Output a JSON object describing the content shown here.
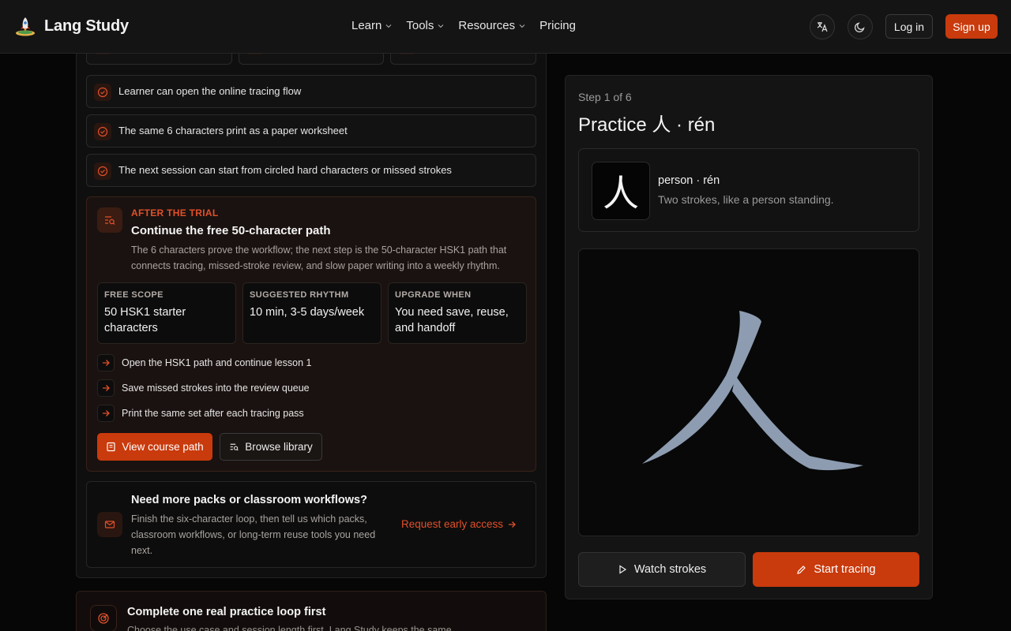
{
  "header": {
    "brand": "Lang Study",
    "nav": [
      {
        "label": "Learn",
        "has_menu": true
      },
      {
        "label": "Tools",
        "has_menu": true
      },
      {
        "label": "Resources",
        "has_menu": true
      },
      {
        "label": "Pricing",
        "has_menu": false
      }
    ],
    "login_label": "Log in",
    "signup_label": "Sign up",
    "icons": [
      "translate-icon",
      "moon-icon"
    ]
  },
  "checklist": [
    "Learner can open the online tracing flow",
    "The same 6 characters print as a paper worksheet",
    "The next session can start from circled hard characters or missed strokes"
  ],
  "trial": {
    "eyebrow": "AFTER THE TRIAL",
    "title": "Continue the free 50-character path",
    "description": "The 6 characters prove the workflow; the next step is the 50-character HSK1 path that connects tracing, missed-stroke review, and slow paper writing into a weekly rhythm.",
    "stats": [
      {
        "label": "FREE SCOPE",
        "value": "50 HSK1 starter characters"
      },
      {
        "label": "SUGGESTED RHYTHM",
        "value": "10 min, 3-5 days/week"
      },
      {
        "label": "UPGRADE WHEN",
        "value": "You need save, reuse, and handoff"
      }
    ],
    "steps": [
      "Open the HSK1 path and continue lesson 1",
      "Save missed strokes into the review queue",
      "Print the same set after each tracing pass"
    ],
    "primary_label": "View course path",
    "secondary_label": "Browse library"
  },
  "more": {
    "title": "Need more packs or classroom workflows?",
    "description": "Finish the six-character loop, then tell us which packs, classroom workflows, or long-term reuse tools you need next.",
    "link_label": "Request early access"
  },
  "loop": {
    "title": "Complete one real practice loop first",
    "description": "Choose the use case and session length first. Lang Study keeps the same"
  },
  "practice": {
    "step_label": "Step 1 of 6",
    "title": "Practice 人 · rén",
    "character": "人",
    "name": "person · rén",
    "hint": "Two strokes, like a person standing.",
    "watch_label": "Watch strokes",
    "trace_label": "Start tracing"
  },
  "colors": {
    "accent": "#c93a0c",
    "accent_text": "#e0502a",
    "stroke_guide": "#8a9ab0"
  }
}
